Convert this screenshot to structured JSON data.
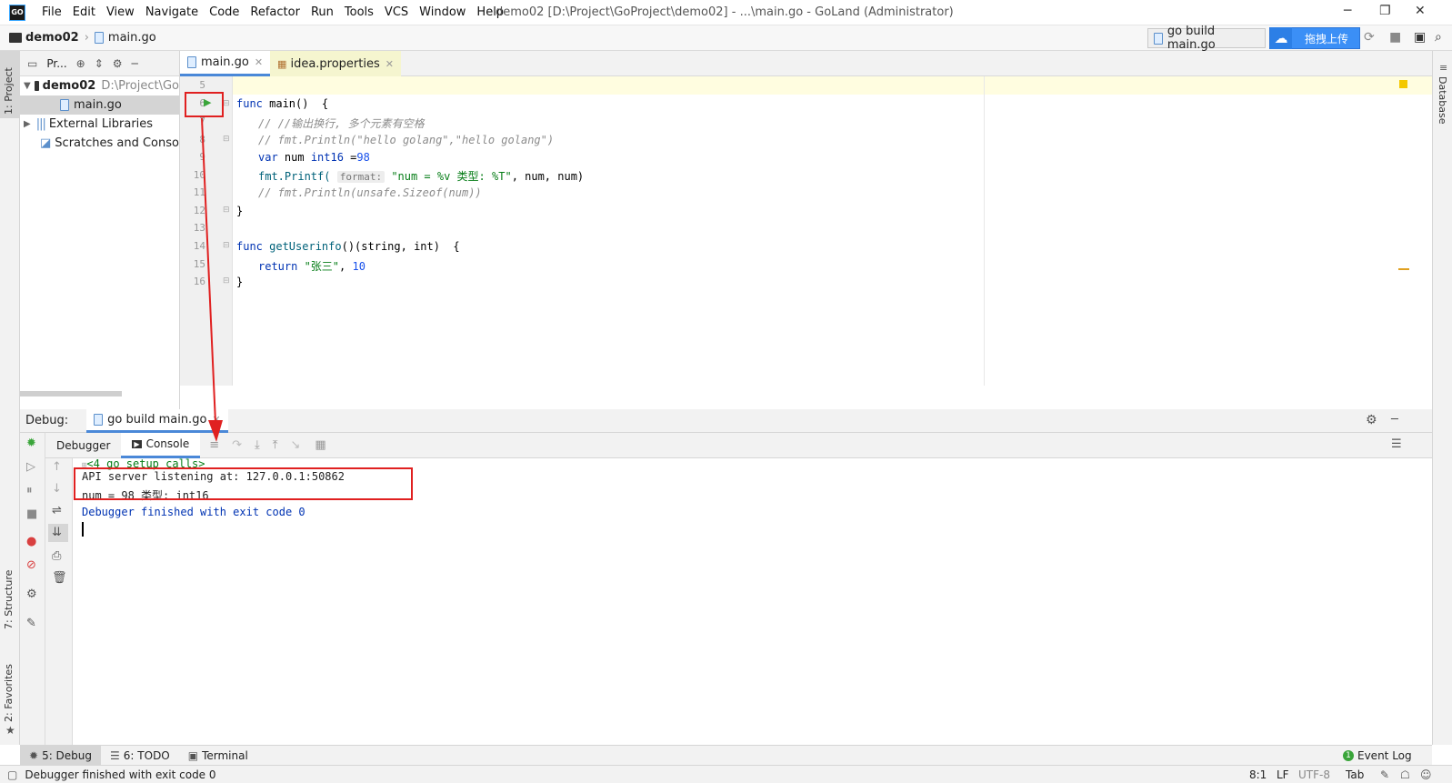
{
  "app": {
    "logo_text": "GO",
    "window_title": "demo02 [D:\\Project\\GoProject\\demo02] - ...\\main.go - GoLand (Administrator)",
    "menu": [
      "File",
      "Edit",
      "View",
      "Navigate",
      "Code",
      "Refactor",
      "Run",
      "Tools",
      "VCS",
      "Window",
      "Help"
    ]
  },
  "navbar": {
    "project": "demo02",
    "file": "main.go",
    "run_config": "go build main.go",
    "baidu_upload": "拖拽上传"
  },
  "left_strip": {
    "project_tab": "1: Project",
    "structure_tab": "7: Structure",
    "favorites_tab": "2: Favorites"
  },
  "right_strip": {
    "database_tab": "Database"
  },
  "project_panel": {
    "toolbar_label": "Pr...",
    "root_name": "demo02",
    "root_path": "D:\\Project\\Go",
    "file": "main.go",
    "external_libs": "External Libraries",
    "scratches": "Scratches and Consoles"
  },
  "editor": {
    "tabs": [
      {
        "label": "main.go"
      },
      {
        "label": "idea.properties"
      }
    ],
    "line_numbers": [
      "5",
      "6",
      "7",
      "8",
      "9",
      "10",
      "11",
      "12",
      "13",
      "14",
      "15",
      "16"
    ],
    "code": {
      "l6_kw": "func",
      "l6_rest": " main()  {",
      "l7": "// //输出换行, 多个元素有空格",
      "l8": "// fmt.Println(\"hello golang\",\"hello golang\")",
      "l9_kw": "var",
      "l9_mid": " num ",
      "l9_type": "int16",
      "l9_eq": " =",
      "l9_num": "98",
      "l10_fn": "fmt.Printf(",
      "l10_hint": "format:",
      "l10_str": "\"num = %v 类型: %T\"",
      "l10_rest": ", num, num)",
      "l11": "// fmt.Println(unsafe.Sizeof(num))",
      "l12": "}",
      "l14_kw": "func",
      "l14_fn": " getUserinfo",
      "l14_rest": "()(string, int)  {",
      "l15_kw": "return",
      "l15_str": " \"张三\"",
      "l15_comma": ", ",
      "l15_num": "10",
      "l16": "}"
    }
  },
  "debug": {
    "label": "Debug:",
    "session_tab": "go build main.go",
    "tabs": {
      "debugger": "Debugger",
      "console": "Console"
    },
    "console_lines": {
      "setup": "<4 go setup calls>",
      "api": "API server listening at: 127.0.0.1:50862",
      "output": "num = 98 类型: int16",
      "finished": "Debugger finished with exit code 0"
    }
  },
  "bottom_tabs": {
    "debug": "5: Debug",
    "todo": "6: TODO",
    "terminal": "Terminal",
    "event_log": "Event Log",
    "event_count": "1"
  },
  "status": {
    "message": "Debugger finished with exit code 0",
    "position": "8:1",
    "line_sep": "LF",
    "encoding": "UTF-8",
    "indent": "Tab"
  },
  "colors": {
    "accent": "#4a88d8",
    "annotation_red": "#e02020",
    "highlight_line": "#fffde0"
  }
}
